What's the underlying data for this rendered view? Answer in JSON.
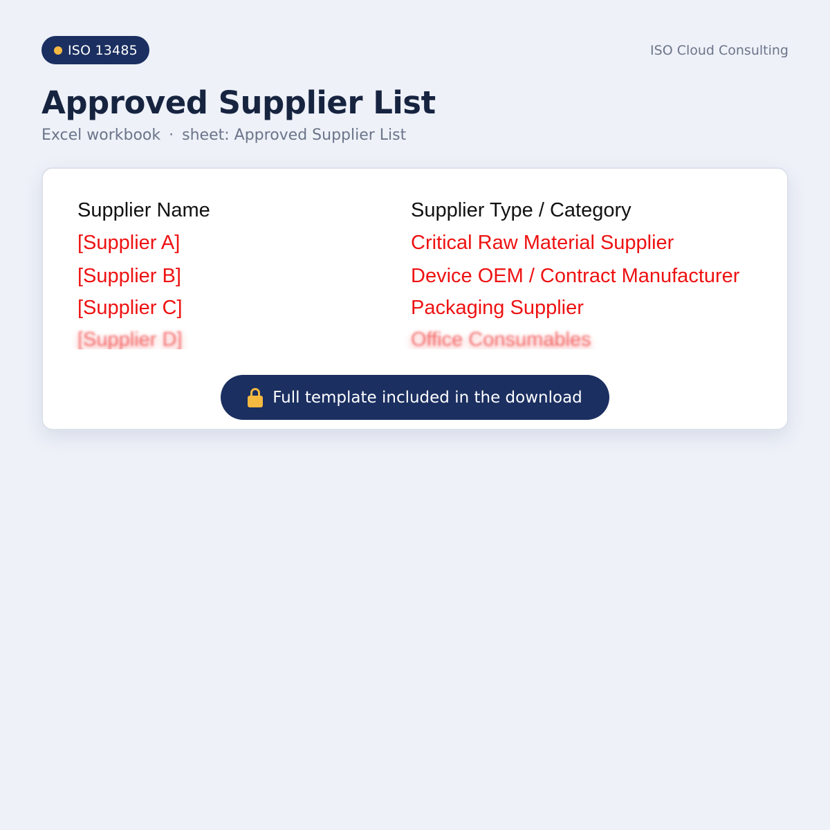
{
  "badge": {
    "label": "ISO 13485",
    "dot_color": "#f5b942",
    "icon": "status-dot-icon"
  },
  "brand": "ISO Cloud Consulting",
  "title": "Approved Supplier List",
  "subtitle": {
    "file_type": "Excel workbook",
    "separator": "·",
    "sheet": "sheet: Approved Supplier List"
  },
  "sheet": {
    "headers": [
      "Supplier Name",
      "Supplier Type / Category"
    ],
    "rows": [
      [
        "[Supplier A]",
        "Critical Raw Material Supplier"
      ],
      [
        "[Supplier B]",
        "Device OEM / Contract Manufacturer"
      ],
      [
        "[Supplier C]",
        "Packaging Supplier"
      ],
      [
        "[Supplier D]",
        "Office Consumables"
      ]
    ]
  },
  "cta": {
    "label": "Full template included in the download",
    "icon": "lock-icon"
  },
  "colors": {
    "accent": "#1b2f61",
    "highlight": "#f5b942",
    "placeholder_text": "#ee1111",
    "background": "#eef1f8"
  }
}
